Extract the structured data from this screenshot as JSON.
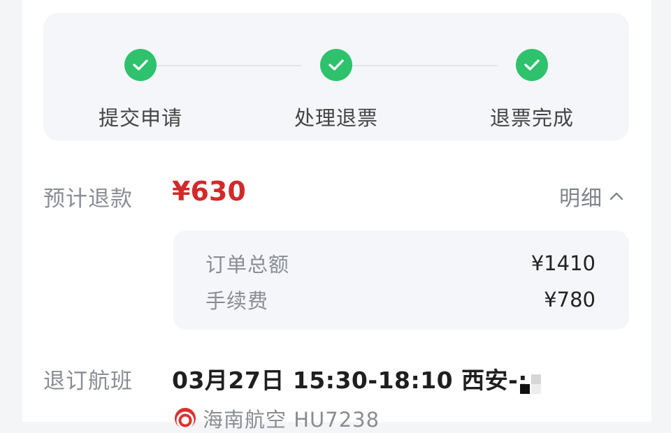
{
  "steps": [
    {
      "label": "提交申请",
      "done": true
    },
    {
      "label": "处理退票",
      "done": true
    },
    {
      "label": "退票完成",
      "done": true
    }
  ],
  "refund": {
    "label": "预计退款",
    "amount": "¥630",
    "detail_label": "明细",
    "detail_icon": "chevron-up-icon"
  },
  "breakdown": {
    "order_total_label": "订单总额",
    "order_total_value": "¥1410",
    "fee_label": "手续费",
    "fee_value": "¥780"
  },
  "flight": {
    "label": "退订航班",
    "summary": "03月27日 15:30-18:10 西安-:",
    "airline": "海南航空 HU7238"
  },
  "colors": {
    "accent_green": "#2dc26b",
    "price_red": "#d12a2a"
  }
}
